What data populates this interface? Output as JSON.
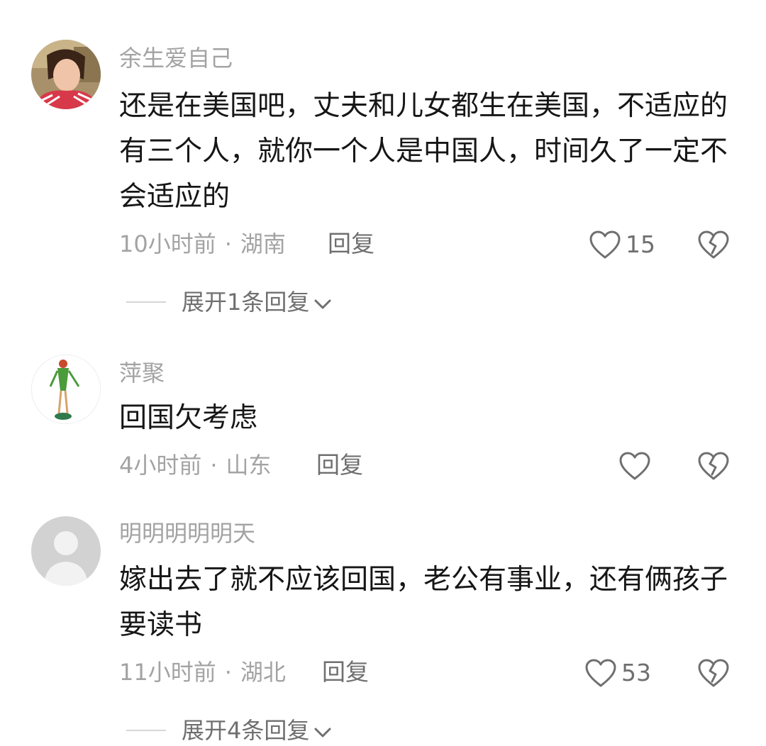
{
  "comments": [
    {
      "username": "余生爱自己",
      "text": "还是在美国吧，丈夫和儿女都生在美国，不适应的有三个人，就你一个人是中国人，时间久了一定不会适应的",
      "time": "10小时前",
      "location": "湖南",
      "reply_label": "回复",
      "likes": "15",
      "expand_label": "展开1条回复"
    },
    {
      "username": "萍聚",
      "text": "回国欠考虑",
      "time": "4小时前",
      "location": "山东",
      "reply_label": "回复",
      "likes": ""
    },
    {
      "username": "明明明明明天",
      "text": "嫁出去了就不应该回国，老公有事业，还有俩孩子要读书",
      "time": "11小时前",
      "location": "湖北",
      "reply_label": "回复",
      "likes": "53",
      "expand_label": "展开4条回复"
    }
  ],
  "meta_separator": "·",
  "icons": {
    "like": "heart-outline-icon",
    "dislike": "broken-heart-icon",
    "expand": "chevron-down-icon"
  },
  "colors": {
    "text": "#161616",
    "muted": "#a3a3a3",
    "action": "#6f6f6f"
  }
}
